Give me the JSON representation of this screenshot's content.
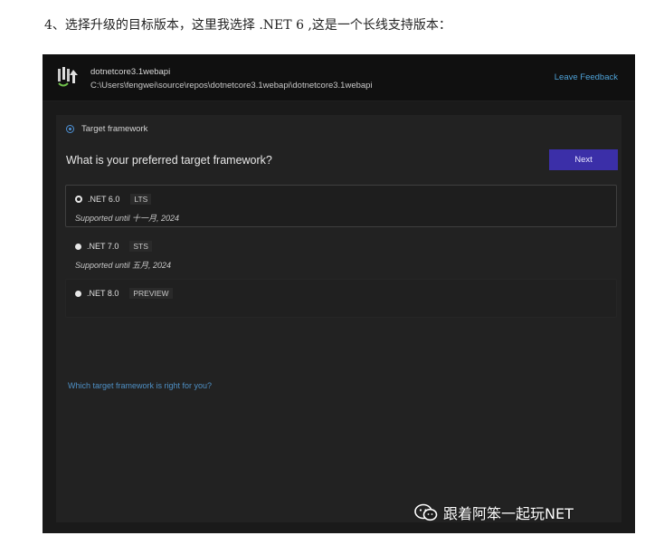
{
  "caption": "4、选择升级的目标版本，这里我选择 .NET 6 ,这是一个长线支持版本：",
  "header": {
    "project_name": "dotnetcore3.1webapi",
    "project_path": "C:\\Users\\fengwei\\source\\repos\\dotnetcore3.1webapi\\dotnetcore3.1webapi",
    "feedback_label": "Leave Feedback",
    "logo_icon": "upgrade-assistant-logo"
  },
  "step": {
    "label": "Target framework",
    "icon": "step-indicator-icon"
  },
  "question": "What is your preferred target framework?",
  "next_label": "Next",
  "options": [
    {
      "version": ".NET 6.0",
      "tag": "LTS",
      "support": "Supported until 十一月, 2024",
      "selected": true
    },
    {
      "version": ".NET 7.0",
      "tag": "STS",
      "support": "Supported until 五月, 2024",
      "selected": false
    },
    {
      "version": ".NET 8.0",
      "tag": "PREVIEW",
      "support": "",
      "selected": false
    }
  ],
  "help_link": "Which target framework is right for you?",
  "watermark": {
    "text": "跟着阿笨一起玩NET",
    "icon": "wechat-icon"
  },
  "colors": {
    "accent_button": "#3b2fa8",
    "link": "#4ea1d6",
    "background": "#1a1a1a"
  }
}
